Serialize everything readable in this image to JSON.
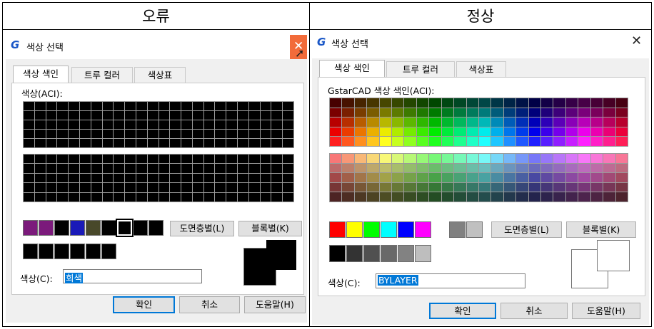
{
  "headers": {
    "left": "오류",
    "right": "정상"
  },
  "left_dialog": {
    "title": "색상 선택",
    "logo": "G",
    "tabs": [
      "색상 색인",
      "트루 컬러",
      "색상표"
    ],
    "group_label": "색상(ACI):",
    "color_field_label": "색상(C):",
    "color_value": "회색",
    "bylayer_button": "도면층별(L)",
    "byblock_button": "블록별(K)",
    "ok_button": "확인",
    "cancel_button": "취소",
    "help_button": "도움말(H)",
    "close_icon": "close-icon",
    "close_color": "#f26b3a",
    "row_swatches": [
      "#7b1a7b",
      "#7b1a7b",
      "#000000",
      "#1a1ab8",
      "#48482a",
      "#000000",
      "#000000",
      "#000000",
      "#000000"
    ],
    "small_swatches": [
      "#000000",
      "#000000",
      "#000000",
      "#000000",
      "#000000",
      "#000000"
    ],
    "preview_color": "#000000"
  },
  "right_dialog": {
    "title": "색상 선택",
    "logo": "G",
    "tabs": [
      "색상 색인",
      "트루 컬러",
      "색상표"
    ],
    "group_label": "GstarCAD 색상 색인(ACI):",
    "color_field_label": "색상(C):",
    "color_value": "BYLAYER",
    "bylayer_button": "도면층별(L)",
    "byblock_button": "블록별(K)",
    "ok_button": "확인",
    "cancel_button": "취소",
    "help_button": "도움말(H)",
    "close_icon": "close-icon",
    "standard_colors": [
      "#ff0000",
      "#ffff00",
      "#00ff00",
      "#00ffff",
      "#0000ff",
      "#ff00ff",
      "#ffffff",
      "#808080",
      "#c0c0c0"
    ],
    "gray_colors": [
      "#000000",
      "#333333",
      "#505050",
      "#696969",
      "#828282",
      "#bebebe",
      "#ffffff"
    ],
    "preview_color": "#ffffff"
  }
}
